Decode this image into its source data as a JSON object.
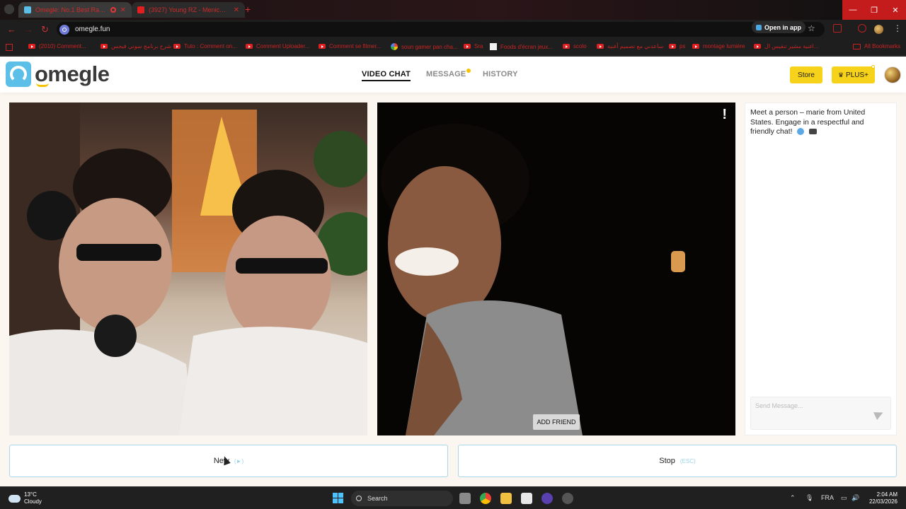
{
  "browser": {
    "tabs": [
      {
        "label": "Omegle: No.1 Best Rando...",
        "active": true
      },
      {
        "label": "(3927) Young RZ - Menich Kifo",
        "active": false
      }
    ],
    "url": "omegle.fun",
    "open_in_app_label": "Open in app",
    "bookmarks": [
      "(2010) Comment...",
      "شرح برنامج سوني فيجس",
      "Tuto : Comment on...",
      "Comment Uploader...",
      "Comment se filmer...",
      "soun gamer pan cha...",
      "Sra",
      "Foods d'écran jeux...",
      "scolo",
      "ساعدني مع تصميم أغنية",
      "ps",
      "montage lumière",
      "اغنية مشير تنفيس ال...",
      "All Bookmarks"
    ]
  },
  "site": {
    "logo_text": "omegle",
    "nav": {
      "video_chat": "VIDEO CHAT",
      "message": "MESSAGE",
      "history": "HISTORY"
    },
    "store_label": "Store",
    "plus_label": "PLUS+"
  },
  "remote_video": {
    "report_icon": "!",
    "add_friend_label": "ADD FRIEND"
  },
  "chat": {
    "intro": "Meet a person – marie from United States. Engage in a respectful and friendly chat!",
    "input_placeholder": "Send Message...",
    "input_value": ""
  },
  "controls": {
    "next_label": "New",
    "next_hint": "(►)",
    "stop_label": "Stop",
    "stop_hint": "(ESC)"
  },
  "taskbar": {
    "weather_temp": "13°C",
    "weather_desc": "Cloudy",
    "search_label": "Search",
    "lang": "FRA",
    "time": "2:04 AM",
    "date": "22/03/2026"
  },
  "colors": {
    "accent_yellow": "#f7d21a",
    "logo_blue": "#5bbfe8",
    "page_bg": "#fbf6ef",
    "button_border": "#a6d8ec"
  }
}
